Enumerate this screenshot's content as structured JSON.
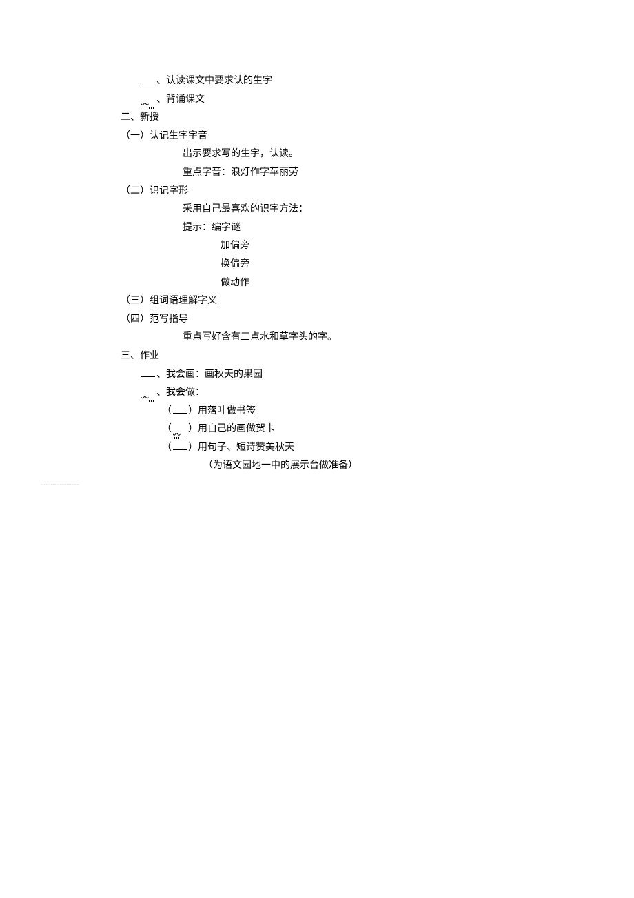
{
  "l1a": "、认读课文中要求认的生字",
  "l1b": "、背诵课文",
  "l2": "二、新授",
  "l3": "（一）认记生字字音",
  "l4": "出示要求写的生字，认读。",
  "l5": "重点字音：浪灯作字苹丽劳",
  "l6": "（二）识记字形",
  "l7": "采用自己最喜欢的识字方法：",
  "l8": "提示：编字谜",
  "l9": "加偏旁",
  "l10": "换偏旁",
  "l11": "做动作",
  "l12": "（三）组词语理解字义",
  "l13": "（四）范写指导",
  "l14": "重点写好含有三点水和草字头的字。",
  "l15": "三、作业",
  "l16a": "、我会画：画秋天的果园",
  "l16b": "、我会做：",
  "l17a": "（",
  "l17b": "）用落叶做书签",
  "l18a": "（",
  "l18b": "）用自己的画做贺卡",
  "l19a": "（",
  "l19b": "）用句子、短诗赞美秋天",
  "l20": "（为语文园地一中的展示台做准备）",
  "bottom": "·································"
}
